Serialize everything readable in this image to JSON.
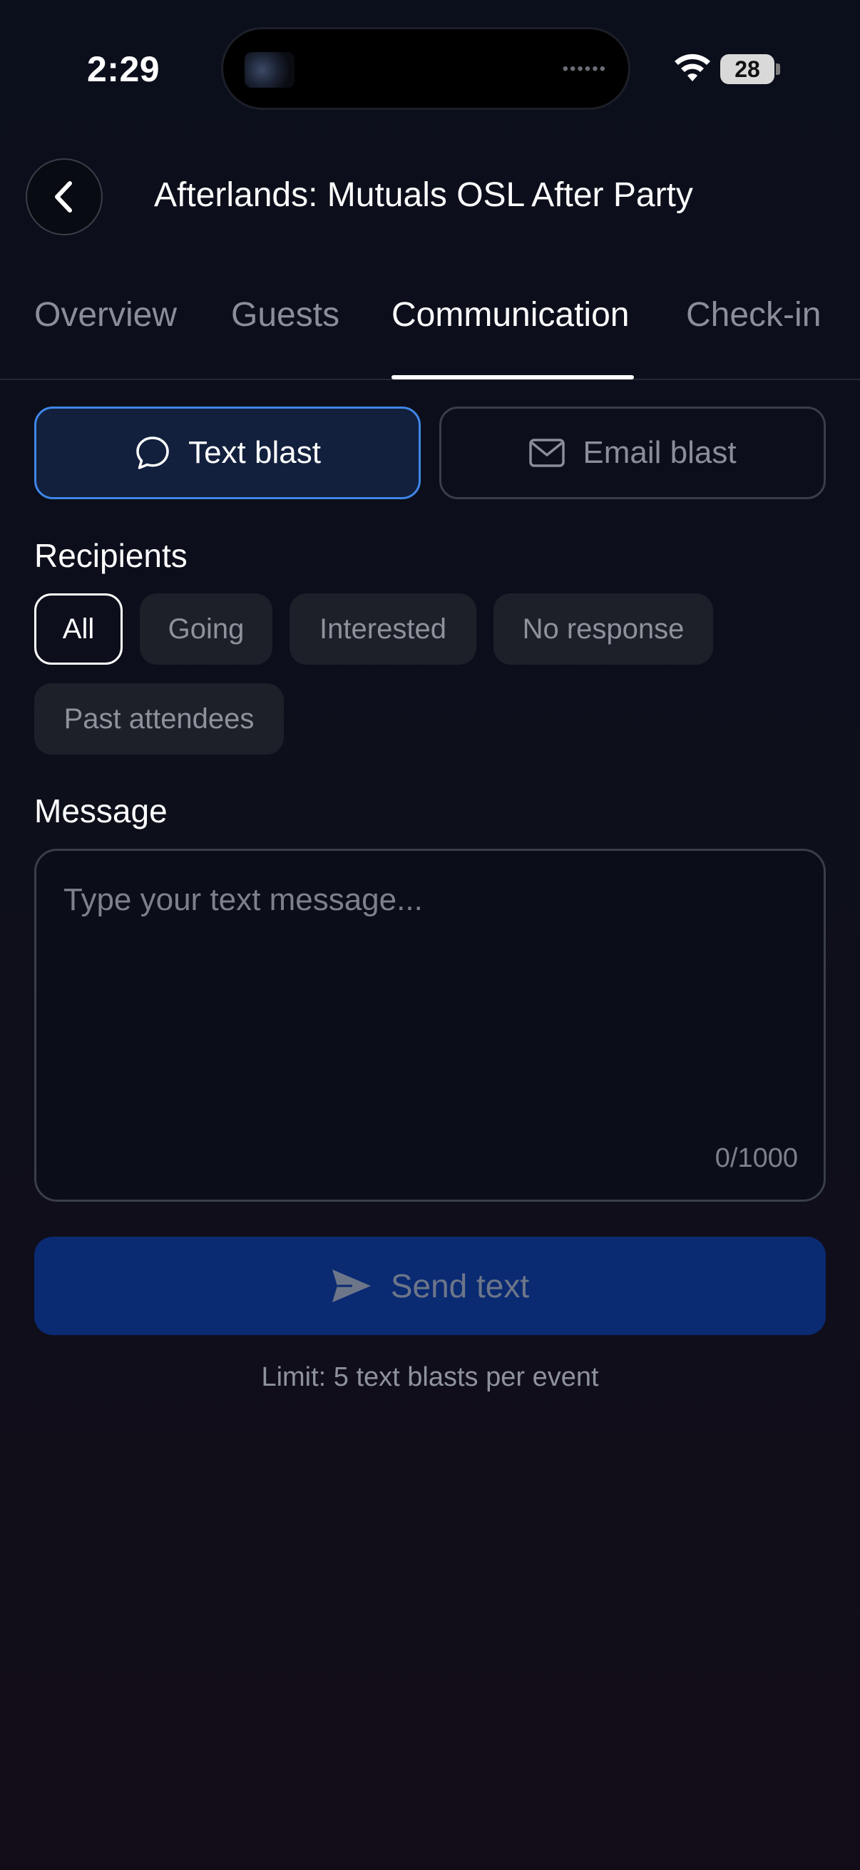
{
  "status_bar": {
    "time": "2:29",
    "battery": "28"
  },
  "header": {
    "title": "Afterlands: Mutuals OSL After Party",
    "back_icon": "chevron-left-icon"
  },
  "tabs": [
    {
      "label": "Overview",
      "active": false
    },
    {
      "label": "Guests",
      "active": false
    },
    {
      "label": "Communication",
      "active": true
    },
    {
      "label": "Check-in",
      "active": false
    }
  ],
  "blast_type": {
    "text": {
      "label": "Text blast",
      "icon": "chat-bubble-icon",
      "selected": true
    },
    "email": {
      "label": "Email blast",
      "icon": "envelope-icon",
      "selected": false
    }
  },
  "recipients": {
    "label": "Recipients",
    "options": [
      {
        "label": "All",
        "selected": true
      },
      {
        "label": "Going",
        "selected": false
      },
      {
        "label": "Interested",
        "selected": false
      },
      {
        "label": "No response",
        "selected": false
      },
      {
        "label": "Past attendees",
        "selected": false
      }
    ]
  },
  "message": {
    "label": "Message",
    "placeholder": "Type your text message...",
    "value": "",
    "counter": "0/1000"
  },
  "send": {
    "label": "Send text",
    "icon": "send-icon",
    "limit_note": "Limit: 5 text blasts per event"
  },
  "colors": {
    "accent": "#3f86e8",
    "send_button": "#0a2a72",
    "background": "#0b0f1b"
  }
}
